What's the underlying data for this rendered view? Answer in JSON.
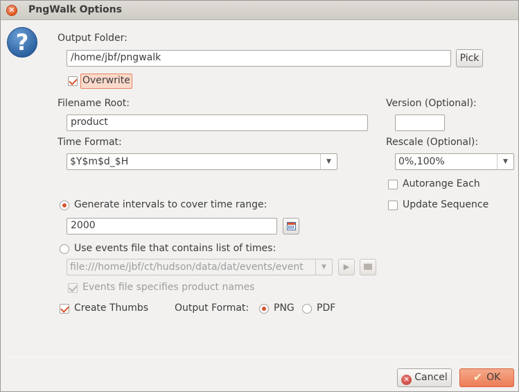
{
  "window": {
    "title": "PngWalk Options",
    "close_icon": "close-icon"
  },
  "output_folder": {
    "label": "Output Folder:",
    "value": "/home/jbf/pngwalk",
    "pick_label": "Pick"
  },
  "overwrite": {
    "label": "Overwrite",
    "checked": true
  },
  "filename_root": {
    "label": "Filename Root:",
    "value": "product"
  },
  "version": {
    "label": "Version (Optional):",
    "value": ""
  },
  "time_format": {
    "label": "Time Format:",
    "value": "$Y$m$d_$H"
  },
  "rescale": {
    "label": "Rescale (Optional):",
    "value": "0%,100%"
  },
  "autorange_each": {
    "label": "Autorange Each",
    "checked": false
  },
  "update_sequence": {
    "label": "Update Sequence",
    "checked": false
  },
  "generate_intervals": {
    "label": "Generate intervals to cover time range:",
    "selected": true,
    "value": "2000"
  },
  "events_file": {
    "label": "Use events file that contains list of times:",
    "selected": false,
    "value": "file:///home/jbf/ct/hudson/data/dat/events/event",
    "product_names_label": "Events file specifies product names",
    "product_names_checked": true
  },
  "create_thumbs": {
    "label": "Create Thumbs",
    "checked": true
  },
  "output_format": {
    "label": "Output Format:",
    "options": [
      "PNG",
      "PDF"
    ],
    "selected": "PNG"
  },
  "buttons": {
    "cancel": "Cancel",
    "ok": "OK"
  },
  "colors": {
    "accent": "#d9532c",
    "ok_button": "#ec7d57",
    "background": "#f2f1f0"
  }
}
